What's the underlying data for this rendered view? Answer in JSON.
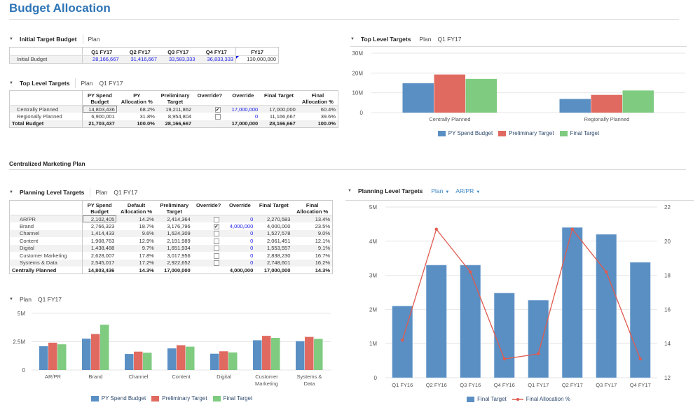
{
  "page": {
    "title": "Budget Allocation"
  },
  "colors": {
    "blue": "#5a8fc3",
    "red": "#e06a60",
    "green": "#7fcb80",
    "accent": "#2e75b6",
    "link_blue": "#1a1ae6",
    "line_red": "#e05a4f"
  },
  "initial_target_budget": {
    "title": "Initial Target Budget",
    "pov": [
      "Plan"
    ],
    "columns": [
      "Q1 FY17",
      "Q2 FY17",
      "Q3 FY17",
      "Q4 FY17",
      "FY17"
    ],
    "rows": [
      {
        "label": "Initial Budget",
        "values": [
          "28,166,667",
          "31,416,667",
          "33,583,333",
          "36,833,333",
          "130,000,000"
        ]
      }
    ]
  },
  "top_level_table": {
    "title": "Top Level Targets",
    "pov": [
      "Plan",
      "Q1 FY17"
    ],
    "columns": [
      [
        "PY Spend",
        "Budget"
      ],
      [
        "PY",
        "Allocation %"
      ],
      [
        "Preliminary",
        "Target"
      ],
      [
        "Override?",
        ""
      ],
      [
        "Override",
        ""
      ],
      [
        "Final Target",
        ""
      ],
      [
        "Final",
        "Allocation %"
      ]
    ],
    "rows": [
      {
        "label": "Centrally Planned",
        "py_spend": "14,803,436",
        "py_alloc": "68.2%",
        "prelim": "19,211,862",
        "override_checked": true,
        "override": "17,000,000",
        "final": "17,000,000",
        "final_alloc": "60.4%"
      },
      {
        "label": "Regionally Planned",
        "py_spend": "6,900,001",
        "py_alloc": "31.8%",
        "prelim": "8,954,804",
        "override_checked": false,
        "override": "0",
        "final": "11,166,667",
        "final_alloc": "39.6%"
      }
    ],
    "total": {
      "label": "Total Budget",
      "py_spend": "21,703,437",
      "py_alloc": "100.0%",
      "prelim": "28,166,667",
      "override": "17,000,000",
      "final": "28,166,667",
      "final_alloc": "100.0%"
    }
  },
  "section2": {
    "title": "Centralized Marketing Plan"
  },
  "planning_level_table": {
    "title": "Planning Level Targets",
    "pov": [
      "Plan",
      "Q1 FY17"
    ],
    "columns": [
      [
        "PY Spend",
        "Budget"
      ],
      [
        "Default",
        "Allocation %"
      ],
      [
        "Preliminary",
        "Target"
      ],
      [
        "Override?",
        ""
      ],
      [
        "Override",
        ""
      ],
      [
        "Final Target",
        ""
      ],
      [
        "Final",
        "Allocation %"
      ]
    ],
    "rows": [
      {
        "label": "AR/PR",
        "py_spend": "2,102,405",
        "def_alloc": "14.2%",
        "prelim": "2,414,364",
        "override_checked": false,
        "override": "0",
        "final": "2,270,583",
        "final_alloc": "13.4%"
      },
      {
        "label": "Brand",
        "py_spend": "2,766,323",
        "def_alloc": "18.7%",
        "prelim": "3,176,796",
        "override_checked": true,
        "override": "4,000,000",
        "final": "4,000,000",
        "final_alloc": "23.5%"
      },
      {
        "label": "Channel",
        "py_spend": "1,414,433",
        "def_alloc": "9.6%",
        "prelim": "1,624,309",
        "override_checked": false,
        "override": "0",
        "final": "1,527,578",
        "final_alloc": "9.0%"
      },
      {
        "label": "Content",
        "py_spend": "1,908,763",
        "def_alloc": "12.9%",
        "prelim": "2,191,989",
        "override_checked": false,
        "override": "0",
        "final": "2,061,451",
        "final_alloc": "12.1%"
      },
      {
        "label": "Digital",
        "py_spend": "1,438,488",
        "def_alloc": "9.7%",
        "prelim": "1,651,934",
        "override_checked": false,
        "override": "0",
        "final": "1,553,557",
        "final_alloc": "9.1%"
      },
      {
        "label": "Customer Marketing",
        "py_spend": "2,628,007",
        "def_alloc": "17.8%",
        "prelim": "3,017,956",
        "override_checked": false,
        "override": "0",
        "final": "2,838,230",
        "final_alloc": "16.7%"
      },
      {
        "label": "Systems & Data",
        "py_spend": "2,545,017",
        "def_alloc": "17.2%",
        "prelim": "2,922,652",
        "override_checked": false,
        "override": "0",
        "final": "2,748,601",
        "final_alloc": "16.2%"
      }
    ],
    "total": {
      "label": "Centrally Planned",
      "py_spend": "14,803,436",
      "def_alloc": "14.3%",
      "prelim": "17,000,000",
      "override": "4,000,000",
      "final": "17,000,000",
      "final_alloc": "14.3%"
    }
  },
  "top_chart_header": {
    "title": "Top Level Targets",
    "pov": [
      "Plan",
      "Q1 FY17"
    ]
  },
  "plan_chart_header": {
    "pov": [
      "Plan",
      "Q1 FY17"
    ]
  },
  "planning_chart_header": {
    "title": "Planning Level Targets",
    "dropdowns": [
      "Plan",
      "AR/PR"
    ]
  },
  "chart_data": [
    {
      "id": "top-level",
      "type": "bar",
      "title": "Top Level Targets",
      "categories": [
        "Centrally Planned",
        "Regionally Planned"
      ],
      "series": [
        {
          "name": "PY Spend Budget",
          "values": [
            14803436,
            6900001
          ]
        },
        {
          "name": "Preliminary Target",
          "values": [
            19211862,
            8954804
          ]
        },
        {
          "name": "Final Target",
          "values": [
            17000000,
            11166667
          ]
        }
      ],
      "ylim": [
        0,
        30000000
      ],
      "yticks": [
        "0",
        "10M",
        "20M",
        "30M"
      ],
      "grid": true,
      "legend": "bottom"
    },
    {
      "id": "plan-by-category",
      "type": "bar",
      "title": "",
      "categories": [
        "AR/PR",
        "Brand",
        "Channel",
        "Content",
        "Digital",
        "Customer Marketing",
        "Systems & Data"
      ],
      "category_lines": [
        [
          "AR/PR"
        ],
        [
          "Brand"
        ],
        [
          "Channel"
        ],
        [
          "Content"
        ],
        [
          "Digital"
        ],
        [
          "Customer",
          "Marketing"
        ],
        [
          "Systems &",
          "Data"
        ]
      ],
      "series": [
        {
          "name": "PY Spend Budget",
          "values": [
            2102405,
            2766323,
            1414433,
            1908763,
            1438488,
            2628007,
            2545017
          ]
        },
        {
          "name": "Preliminary Target",
          "values": [
            2414364,
            3176796,
            1624309,
            2191989,
            1651934,
            3017956,
            2922652
          ]
        },
        {
          "name": "Final Target",
          "values": [
            2270583,
            4000000,
            1527578,
            2061451,
            1553557,
            2838230,
            2748601
          ]
        }
      ],
      "ylim": [
        0,
        5000000
      ],
      "yticks": [
        "0",
        "2.5M",
        "5M"
      ],
      "grid": true,
      "legend": "bottom"
    },
    {
      "id": "planning-level",
      "type": "bar",
      "title": "Planning Level Targets",
      "categories": [
        "Q1 FY16",
        "Q2 FY16",
        "Q3 FY16",
        "Q4 FY16",
        "Q1 FY17",
        "Q2 FY17",
        "Q3 FY17",
        "Q4 FY17"
      ],
      "series": [
        {
          "name": "Final Target",
          "type": "bar",
          "axis": "left",
          "values": [
            2100000,
            3300000,
            3300000,
            2480000,
            2270000,
            4400000,
            4200000,
            3380000
          ]
        },
        {
          "name": "Final Allocation %",
          "type": "line",
          "axis": "right",
          "values": [
            14.2,
            20.7,
            18.2,
            13.1,
            13.4,
            20.7,
            18.2,
            13.1
          ]
        }
      ],
      "ylim": [
        0,
        5000000
      ],
      "yticks": [
        "0",
        "1M",
        "2M",
        "3M",
        "4M",
        "5M"
      ],
      "y2lim": [
        12,
        22
      ],
      "y2ticks": [
        "12",
        "14",
        "16",
        "18",
        "20",
        "22"
      ],
      "grid": true,
      "legend": "bottom"
    }
  ]
}
